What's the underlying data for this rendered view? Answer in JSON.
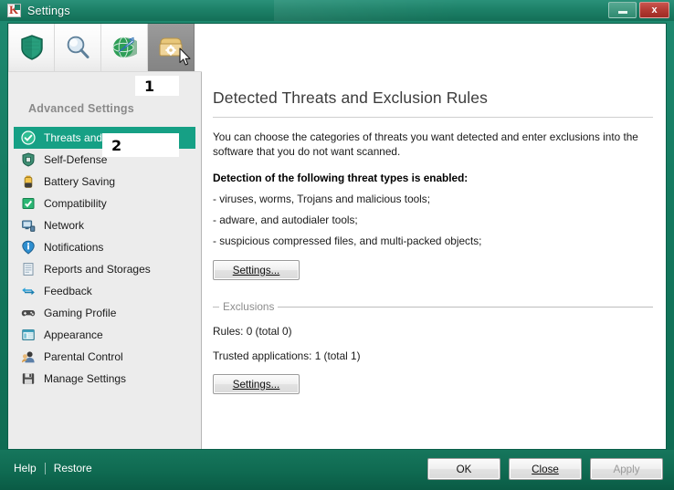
{
  "window": {
    "title": "Settings",
    "logo_icon": "kaspersky-logo-icon",
    "minimize_label": "",
    "close_label": "x"
  },
  "toolbar": {
    "items": [
      {
        "icon": "shield-icon",
        "name": "protection-center-tab"
      },
      {
        "icon": "magnifier-icon",
        "name": "scan-tab"
      },
      {
        "icon": "globe-update-icon",
        "name": "update-tab"
      },
      {
        "icon": "folder-gear-icon",
        "name": "advanced-settings-tab"
      }
    ],
    "active_index": 3
  },
  "sidebar": {
    "heading": "Advanced Settings",
    "items": [
      {
        "label": "Threats and Exclusions",
        "icon": "check-shield-icon",
        "selected": true
      },
      {
        "label": "Self-Defense",
        "icon": "self-defense-shield-icon",
        "selected": false
      },
      {
        "label": "Battery Saving",
        "icon": "battery-icon",
        "selected": false
      },
      {
        "label": "Compatibility",
        "icon": "compatibility-check-icon",
        "selected": false
      },
      {
        "label": "Network",
        "icon": "network-monitor-icon",
        "selected": false
      },
      {
        "label": "Notifications",
        "icon": "info-balloon-icon",
        "selected": false
      },
      {
        "label": "Reports and Storages",
        "icon": "report-page-icon",
        "selected": false
      },
      {
        "label": "Feedback",
        "icon": "feedback-arrows-icon",
        "selected": false
      },
      {
        "label": "Gaming Profile",
        "icon": "gamepad-icon",
        "selected": false
      },
      {
        "label": "Appearance",
        "icon": "appearance-window-icon",
        "selected": false
      },
      {
        "label": "Parental Control",
        "icon": "parental-control-user-icon",
        "selected": false
      },
      {
        "label": "Manage Settings",
        "icon": "floppy-disk-icon",
        "selected": false
      }
    ]
  },
  "content": {
    "title": "Detected Threats and Exclusion Rules",
    "intro": "You can choose the categories of threats you want detected and enter exclusions into the software that you do not want scanned.",
    "detection_heading": "Detection of the following threat types is enabled:",
    "threat_types": [
      "- viruses, worms, Trojans and malicious tools;",
      "- adware, and autodialer tools;",
      "- suspicious compressed files, and multi-packed objects;"
    ],
    "detection_settings_button": "Settings...",
    "exclusions": {
      "group_title": "Exclusions",
      "rules_text": "Rules: 0 (total 0)",
      "trusted_text": "Trusted applications: 1 (total 1)",
      "settings_button": "Settings..."
    }
  },
  "statusbar": {
    "help_label": "Help",
    "restore_label": "Restore",
    "ok_label": "OK",
    "close_label": "Close",
    "apply_label": "Apply"
  },
  "annotations": [
    {
      "label": "1"
    },
    {
      "label": "2"
    }
  ],
  "colors": {
    "titlebar_teal": "#1d8168",
    "selection_green": "#16a085",
    "close_red": "#b33b33",
    "sidebar_gray": "#ececec"
  }
}
